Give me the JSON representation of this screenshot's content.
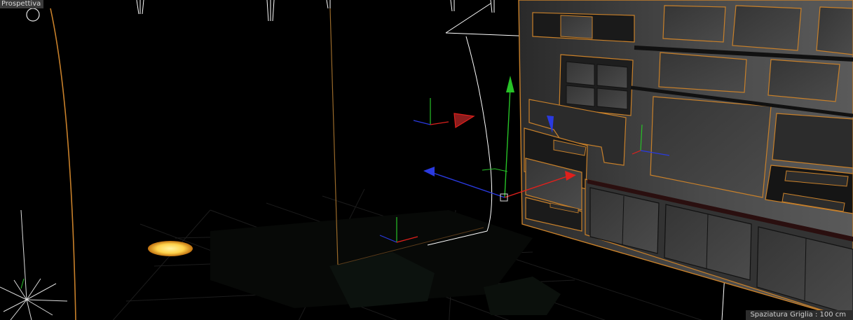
{
  "viewport": {
    "view_name": "Prospettiva",
    "grid_spacing": "Spaziatura Griglia : 100 cm"
  },
  "colors": {
    "background": "#000000",
    "selection_outline": "#c8802a",
    "panel_fill": "#3a3a3a",
    "axis_x": "#e0201c",
    "axis_y": "#27c227",
    "axis_z": "#2a3ae0",
    "light_outline": "#ffffff"
  },
  "icons": [
    "camera-icon",
    "light-icon",
    "move-gizmo",
    "axis-icon"
  ]
}
